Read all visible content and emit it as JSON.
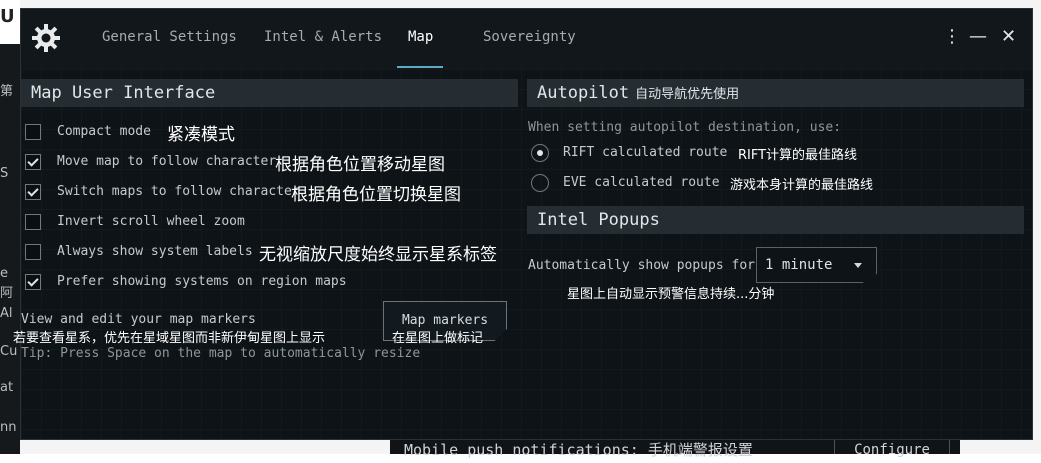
{
  "tabs": [
    {
      "label": "General Settings",
      "active": false
    },
    {
      "label": "Intel & Alerts",
      "active": false
    },
    {
      "label": "Map",
      "active": true
    },
    {
      "label": "Sovereignty",
      "active": false
    }
  ],
  "window_controls": {
    "menu": "⋮",
    "minimize": "—",
    "close": "✕"
  },
  "map_ui": {
    "header": "Map User Interface",
    "options": [
      {
        "label": "Compact mode",
        "cn": "紧凑模式",
        "checked": false
      },
      {
        "label": "Move map to follow character",
        "cn": "根据角色位置移动星图",
        "checked": true
      },
      {
        "label": "Switch maps to follow character",
        "cn": "根据角色位置切换星图",
        "checked": true
      },
      {
        "label": "Invert scroll wheel zoom",
        "cn": "",
        "checked": false
      },
      {
        "label": "Always show system labels",
        "cn": "无视缩放尺度始终显示星系标签",
        "checked": false
      },
      {
        "label": "Prefer showing systems on region maps",
        "cn": "",
        "checked": true
      }
    ],
    "markers_text": "View and edit your map markers",
    "markers_cn": "若要查看星系，优先在星域星图而非新伊甸星图上显示",
    "markers_button": "Map markers",
    "markers_button_cn": "在星图上做标记",
    "tip": "Tip: Press Space on the map to automatically resize"
  },
  "autopilot": {
    "header": "Autopilot",
    "header_cn": "自动导航优先使用",
    "description": "When setting autopilot destination, use:",
    "options": [
      {
        "label": "RIFT calculated route",
        "cn": "RIFT计算的最佳路线",
        "checked": true
      },
      {
        "label": "EVE calculated route",
        "cn": "游戏本身计算的最佳路线",
        "checked": false
      }
    ]
  },
  "intel_popups": {
    "header": "Intel Popups",
    "label": "Automatically show popups for:",
    "selected": "1 minute",
    "cn": "星图上自动显示预警信息持续...分钟"
  },
  "background": {
    "mobile_label": "Mobile push notifications: 手机端警报设置",
    "configure": "Configure",
    "left_fragments": [
      "U",
      "第",
      "S",
      "e",
      "阿",
      "Al",
      "Cu",
      "at",
      "nn"
    ]
  },
  "colors": {
    "accent": "#5fa8c8",
    "window_bg": "#0e1317",
    "header_bg": "#252d33"
  }
}
